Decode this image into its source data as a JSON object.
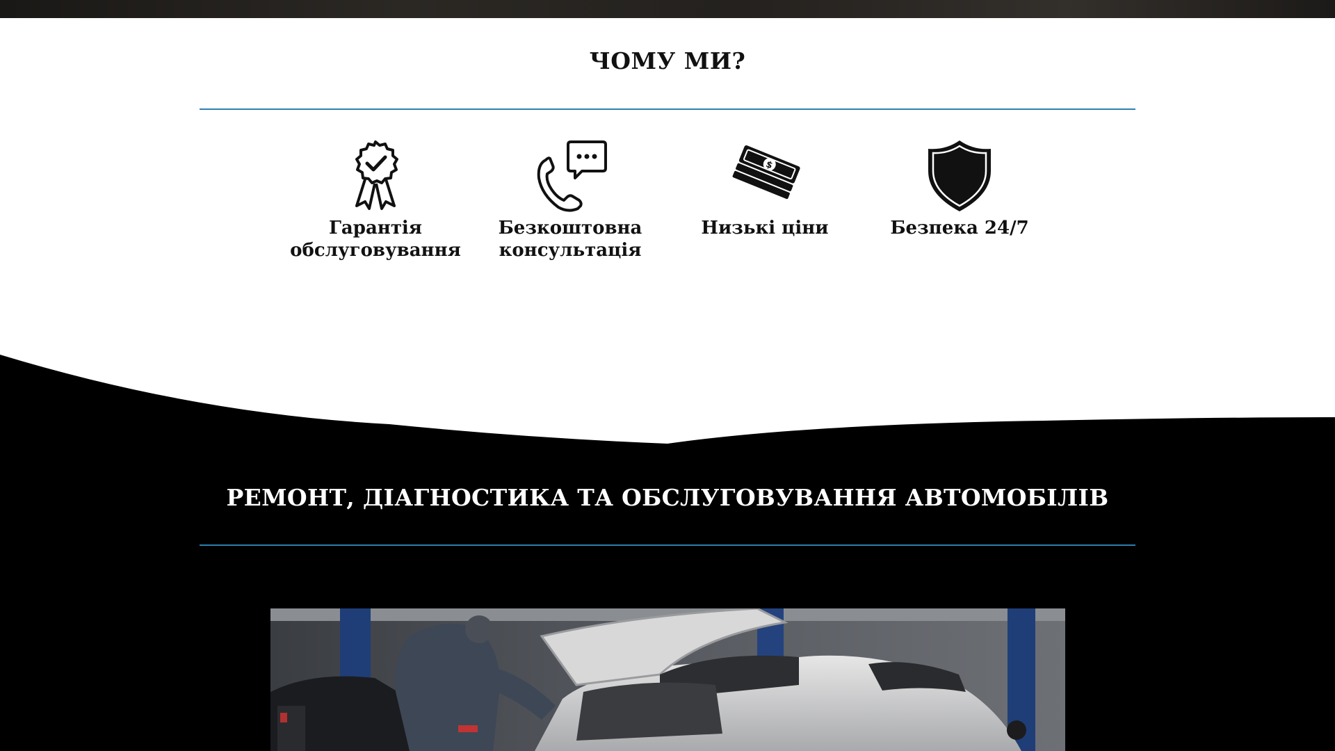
{
  "why_us": {
    "title": "ЧОМУ МИ?",
    "features": [
      {
        "label_line1": "Гарантія",
        "label_line2": "обслуговування",
        "icon": "award-ribbon-icon"
      },
      {
        "label_line1": "Безкоштовна",
        "label_line2": "консультація",
        "icon": "phone-chat-icon"
      },
      {
        "label_line1": "Низькі ціни",
        "label_line2": "",
        "icon": "money-stack-icon"
      },
      {
        "label_line1": "Безпека 24/7",
        "label_line2": "",
        "icon": "shield-icon"
      }
    ]
  },
  "services": {
    "title": "РЕМОНТ, ДІАГНОСТИКА ТА ОБСЛУГОВУВАННЯ АВТОМОБІЛІВ",
    "photo": "car-repair-photo"
  },
  "colors": {
    "accent_line": "#2f7fb0",
    "dark_bg": "#000000",
    "text_dark": "#111111",
    "text_light": "#ffffff"
  }
}
